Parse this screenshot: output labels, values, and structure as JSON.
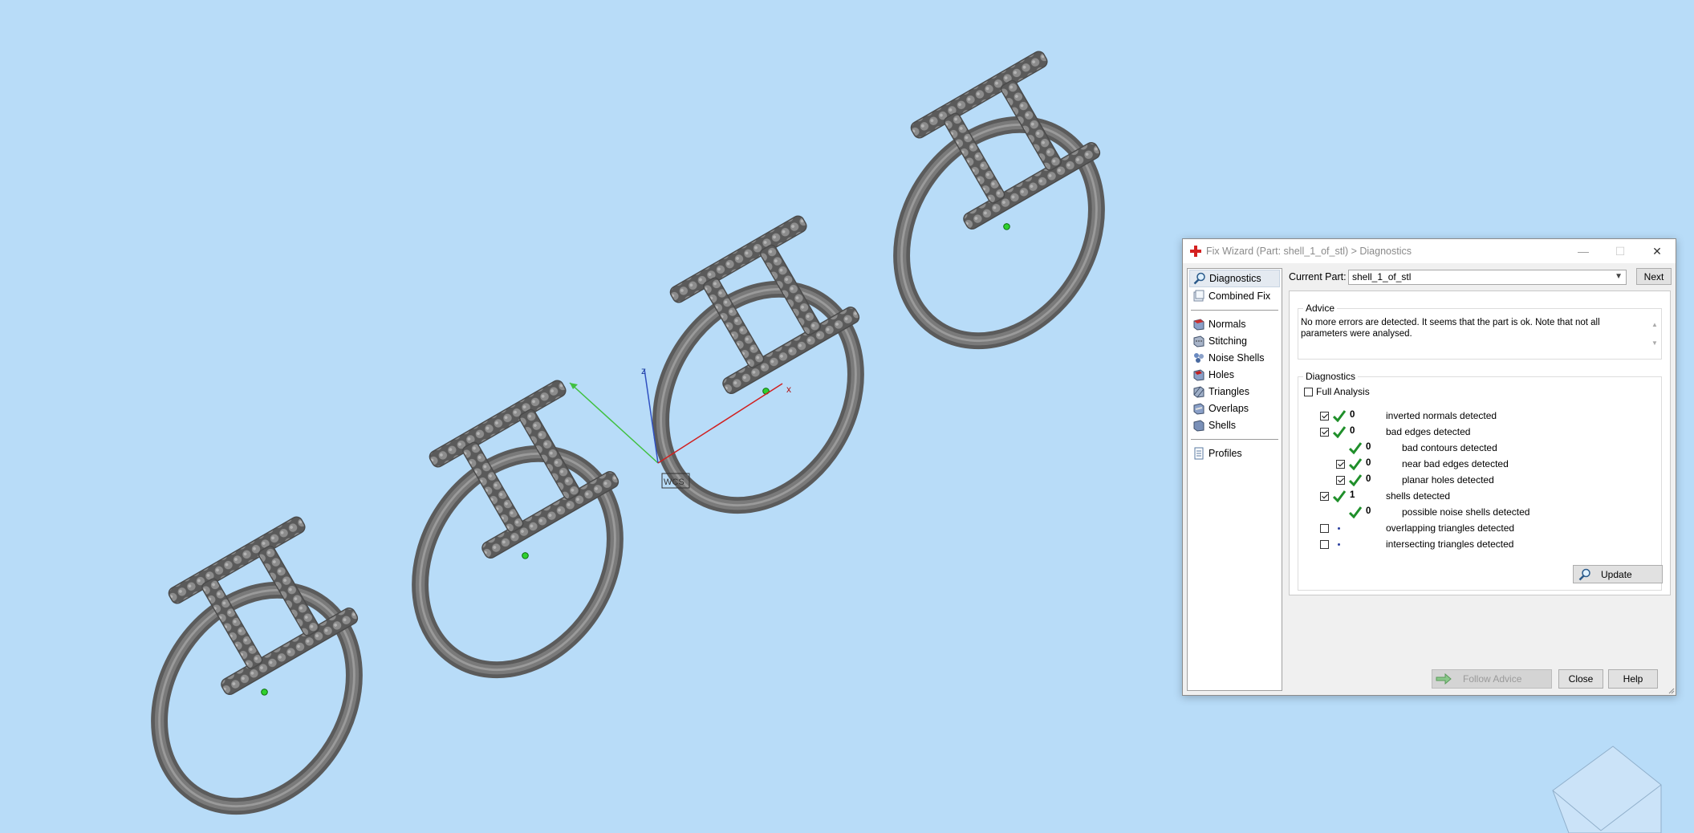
{
  "window": {
    "title": "Fix Wizard (Part: shell_1_of_stl) > Diagnostics",
    "minimize": "—",
    "maximize": "☐",
    "close": "✕"
  },
  "viewport": {
    "axis_x": "x",
    "axis_z": "z",
    "wcs_label": "WCS"
  },
  "nav": {
    "items": [
      {
        "label": "Diagnostics",
        "icon": "magnifier-icon",
        "selected": true
      },
      {
        "label": "Combined Fix",
        "icon": "combined-fix-icon"
      },
      {
        "label": "Normals",
        "icon": "normals-icon"
      },
      {
        "label": "Stitching",
        "icon": "stitching-icon"
      },
      {
        "label": "Noise Shells",
        "icon": "noise-shells-icon"
      },
      {
        "label": "Holes",
        "icon": "holes-icon"
      },
      {
        "label": "Triangles",
        "icon": "triangles-icon"
      },
      {
        "label": "Overlaps",
        "icon": "overlaps-icon"
      },
      {
        "label": "Shells",
        "icon": "shells-icon"
      },
      {
        "label": "Profiles",
        "icon": "profiles-icon"
      }
    ]
  },
  "current_part": {
    "label": "Current Part:",
    "value": "shell_1_of_stl",
    "next_label": "Next"
  },
  "advice": {
    "title": "Advice",
    "text": "No more errors are detected. It seems that the part is ok. Note that not all parameters were analysed."
  },
  "diagnostics": {
    "title": "Diagnostics",
    "full_analysis_label": "Full Analysis",
    "rows": [
      {
        "count": "0",
        "label": "inverted normals detected"
      },
      {
        "count": "0",
        "label": "bad edges detected"
      },
      {
        "count": "0",
        "label": "bad contours detected"
      },
      {
        "count": "0",
        "label": "near bad edges detected"
      },
      {
        "count": "0",
        "label": "planar holes detected"
      },
      {
        "count": "1",
        "label": "shells detected"
      },
      {
        "count": "0",
        "label": "possible noise shells detected"
      },
      {
        "count": "",
        "label": "overlapping triangles detected"
      },
      {
        "count": "",
        "label": "intersecting triangles detected"
      }
    ],
    "update_label": "Update"
  },
  "buttons": {
    "follow_advice": "Follow Advice",
    "close": "Close",
    "help": "Help"
  },
  "colors": {
    "background": "#b8dcf8",
    "ring": "#6e6e6e",
    "check_green": "#1f8f2a",
    "axis_x": "#d02020",
    "axis_y": "#40c040",
    "axis_z": "#3050c0"
  }
}
